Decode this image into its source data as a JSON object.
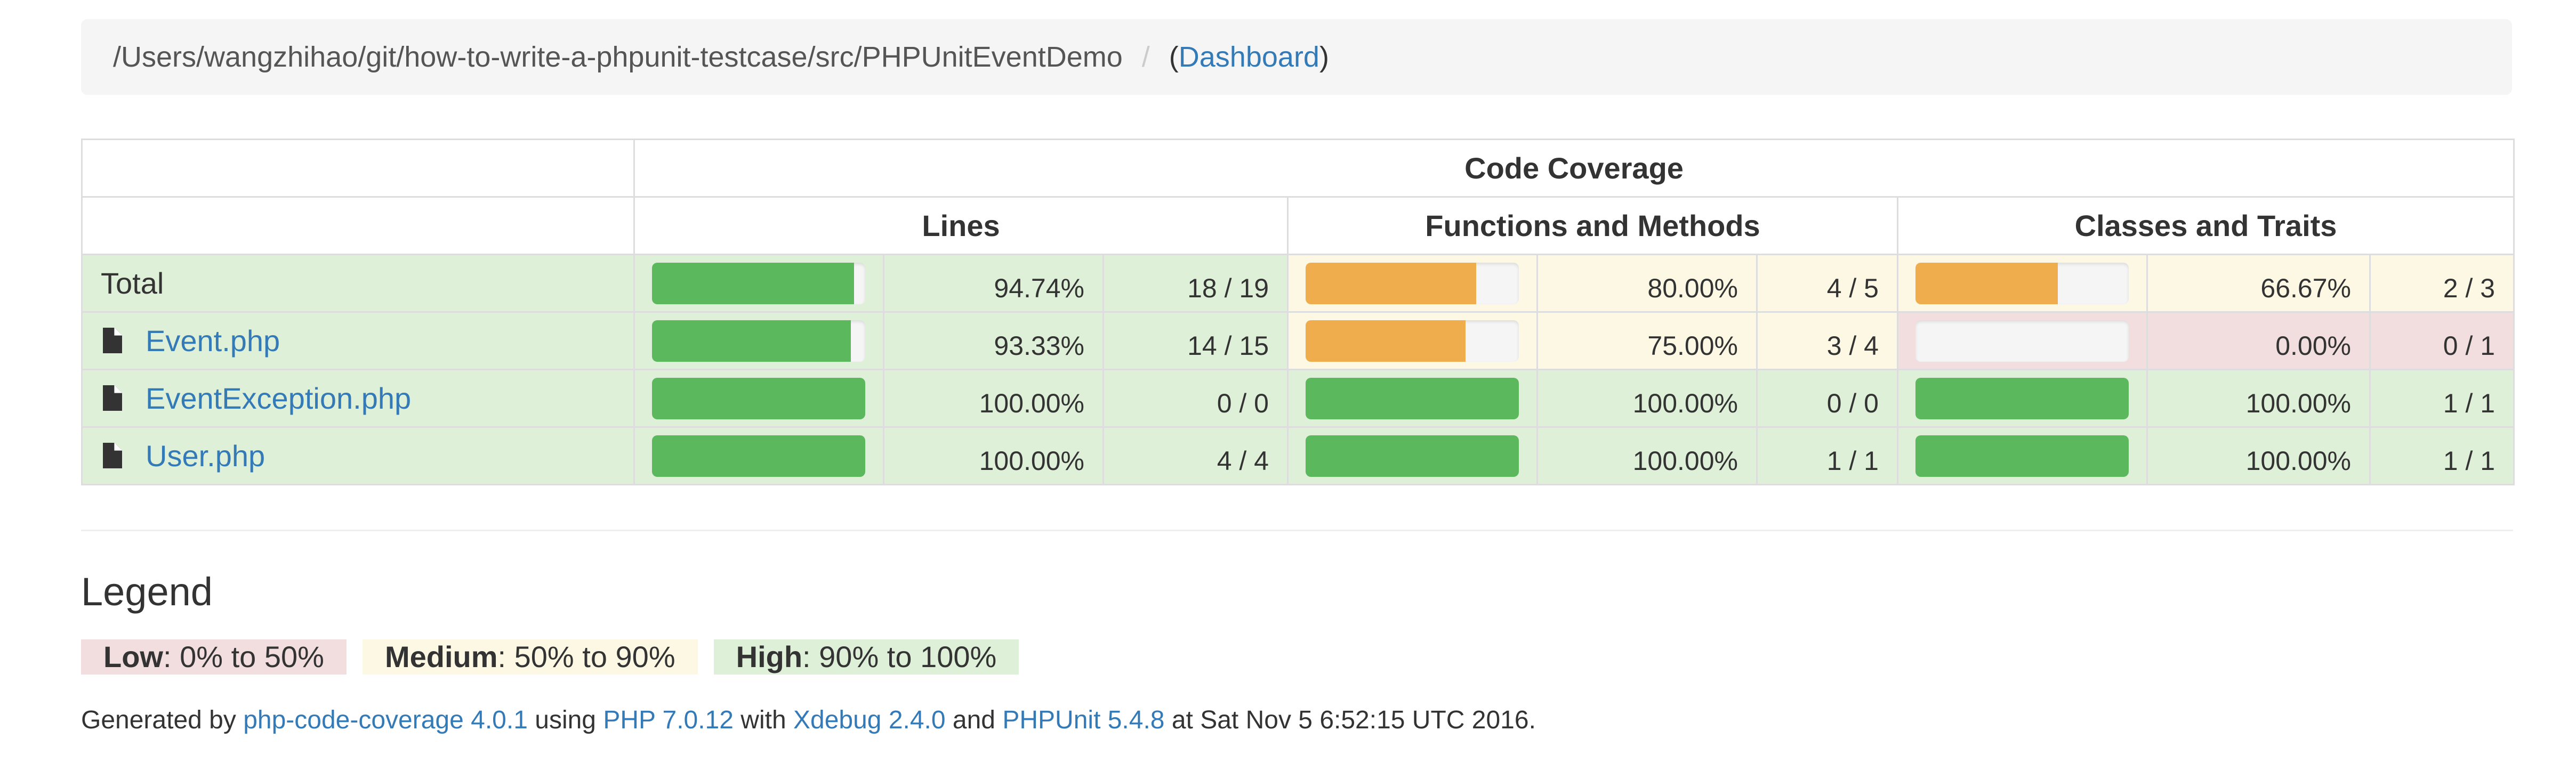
{
  "breadcrumb": {
    "path": "/Users/wangzhihao/git/how-to-write-a-phpunit-testcase/src/PHPUnitEventDemo",
    "separator": "/",
    "dashboard_link": "Dashboard",
    "open_paren": "(",
    "close_paren": ")"
  },
  "table": {
    "header_code_coverage": "Code Coverage",
    "header_lines": "Lines",
    "header_functions": "Functions and Methods",
    "header_classes": "Classes and Traits",
    "rows": [
      {
        "name": "Total",
        "is_link": false,
        "lines": {
          "pct": "94.74%",
          "ratio": "18 / 19",
          "fill": 0.9474,
          "level": "success"
        },
        "functions": {
          "pct": "80.00%",
          "ratio": "4 / 5",
          "fill": 0.8,
          "level": "warning"
        },
        "classes": {
          "pct": "66.67%",
          "ratio": "2 / 3",
          "fill": 0.6667,
          "level": "warning"
        }
      },
      {
        "name": "Event.php",
        "is_link": true,
        "lines": {
          "pct": "93.33%",
          "ratio": "14 / 15",
          "fill": 0.9333,
          "level": "success"
        },
        "functions": {
          "pct": "75.00%",
          "ratio": "3 / 4",
          "fill": 0.75,
          "level": "warning"
        },
        "classes": {
          "pct": "0.00%",
          "ratio": "0 / 1",
          "fill": 0.0,
          "level": "danger"
        }
      },
      {
        "name": "EventException.php",
        "is_link": true,
        "lines": {
          "pct": "100.00%",
          "ratio": "0 / 0",
          "fill": 1.0,
          "level": "success"
        },
        "functions": {
          "pct": "100.00%",
          "ratio": "0 / 0",
          "fill": 1.0,
          "level": "success"
        },
        "classes": {
          "pct": "100.00%",
          "ratio": "1 / 1",
          "fill": 1.0,
          "level": "success"
        }
      },
      {
        "name": "User.php",
        "is_link": true,
        "lines": {
          "pct": "100.00%",
          "ratio": "4 / 4",
          "fill": 1.0,
          "level": "success"
        },
        "functions": {
          "pct": "100.00%",
          "ratio": "1 / 1",
          "fill": 1.0,
          "level": "success"
        },
        "classes": {
          "pct": "100.00%",
          "ratio": "1 / 1",
          "fill": 1.0,
          "level": "success"
        }
      }
    ]
  },
  "legend": {
    "title": "Legend",
    "low_label": "Low",
    "low_range": ": 0% to 50%",
    "medium_label": "Medium",
    "medium_range": ": 50% to 90%",
    "high_label": "High",
    "high_range": ": 90% to 100%"
  },
  "footer": {
    "generated_by": "Generated by ",
    "coverage_link": "php-code-coverage 4.0.1",
    "using": " using ",
    "php_link": "PHP 7.0.12",
    "with": " with ",
    "xdebug_link": "Xdebug 2.4.0",
    "and": " and ",
    "phpunit_link": "PHPUnit 5.4.8",
    "at": " at Sat Nov 5 6:52:15 UTC 2016."
  },
  "colors": {
    "success_bg": "#dff0d8",
    "warning_bg": "#fcf8e3",
    "danger_bg": "#f2dede",
    "success_bar": "#5cb85c",
    "warning_bar": "#f0ad4e",
    "link": "#337ab7"
  },
  "icons": {
    "file": "file-icon"
  }
}
